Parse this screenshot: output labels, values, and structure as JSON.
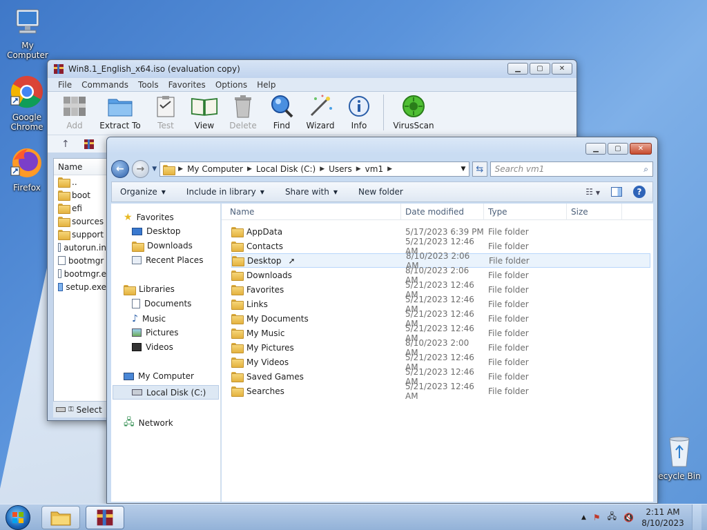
{
  "desktop": {
    "icons": [
      {
        "label": "My Computer",
        "icon": "computer-icon"
      },
      {
        "label": "Google Chrome",
        "icon": "chrome-icon"
      },
      {
        "label": "Firefox",
        "icon": "firefox-icon"
      },
      {
        "label": "ecycle Bin",
        "icon": "recycle-bin-icon"
      }
    ]
  },
  "winrar": {
    "title": "Win8.1_English_x64.iso (evaluation copy)",
    "menu": [
      "File",
      "Commands",
      "Tools",
      "Favorites",
      "Options",
      "Help"
    ],
    "toolbar": [
      {
        "label": "Add",
        "icon": "add-archive-icon",
        "enabled": false
      },
      {
        "label": "Extract To",
        "icon": "extract-folder-icon",
        "enabled": true
      },
      {
        "label": "Test",
        "icon": "test-clipboard-icon",
        "enabled": false
      },
      {
        "label": "View",
        "icon": "view-book-icon",
        "enabled": true
      },
      {
        "label": "Delete",
        "icon": "trash-icon",
        "enabled": false
      },
      {
        "label": "Find",
        "icon": "magnifier-icon",
        "enabled": true
      },
      {
        "label": "Wizard",
        "icon": "wizard-wand-icon",
        "enabled": true
      },
      {
        "label": "Info",
        "icon": "info-icon",
        "enabled": true
      },
      {
        "label": "VirusScan",
        "icon": "virus-scan-icon",
        "enabled": true
      }
    ],
    "list_header": "Name",
    "files": [
      "..",
      "boot",
      "efi",
      "sources",
      "support",
      "autorun.in",
      "bootmgr",
      "bootmgr.e",
      "setup.exe"
    ],
    "status": "Select"
  },
  "explorer": {
    "address": [
      "My Computer",
      "Local Disk (C:)",
      "Users",
      "vm1"
    ],
    "search_placeholder": "Search vm1",
    "commands": [
      "Organize",
      "Include in library",
      "Share with",
      "New folder"
    ],
    "nav": {
      "favorites": "Favorites",
      "favorites_items": [
        "Desktop",
        "Downloads",
        "Recent Places"
      ],
      "libraries": "Libraries",
      "libraries_items": [
        "Documents",
        "Music",
        "Pictures",
        "Videos"
      ],
      "computer": "My Computer",
      "computer_items": [
        "Local Disk (C:)"
      ],
      "network": "Network"
    },
    "columns": [
      "Name",
      "Date modified",
      "Type",
      "Size"
    ],
    "rows": [
      {
        "name": "AppData",
        "date": "5/17/2023 6:39 PM",
        "type": "File folder"
      },
      {
        "name": "Contacts",
        "date": "5/21/2023 12:46 AM",
        "type": "File folder"
      },
      {
        "name": "Desktop",
        "date": "8/10/2023 2:06 AM",
        "type": "File folder"
      },
      {
        "name": "Downloads",
        "date": "8/10/2023 2:06 AM",
        "type": "File folder"
      },
      {
        "name": "Favorites",
        "date": "5/21/2023 12:46 AM",
        "type": "File folder"
      },
      {
        "name": "Links",
        "date": "5/21/2023 12:46 AM",
        "type": "File folder"
      },
      {
        "name": "My Documents",
        "date": "5/21/2023 12:46 AM",
        "type": "File folder"
      },
      {
        "name": "My Music",
        "date": "5/21/2023 12:46 AM",
        "type": "File folder"
      },
      {
        "name": "My Pictures",
        "date": "8/10/2023 2:00 AM",
        "type": "File folder"
      },
      {
        "name": "My Videos",
        "date": "5/21/2023 12:46 AM",
        "type": "File folder"
      },
      {
        "name": "Saved Games",
        "date": "5/21/2023 12:46 AM",
        "type": "File folder"
      },
      {
        "name": "Searches",
        "date": "5/21/2023 12:46 AM",
        "type": "File folder"
      }
    ]
  },
  "taskbar": {
    "time": "2:11 AM",
    "date": "8/10/2023"
  }
}
